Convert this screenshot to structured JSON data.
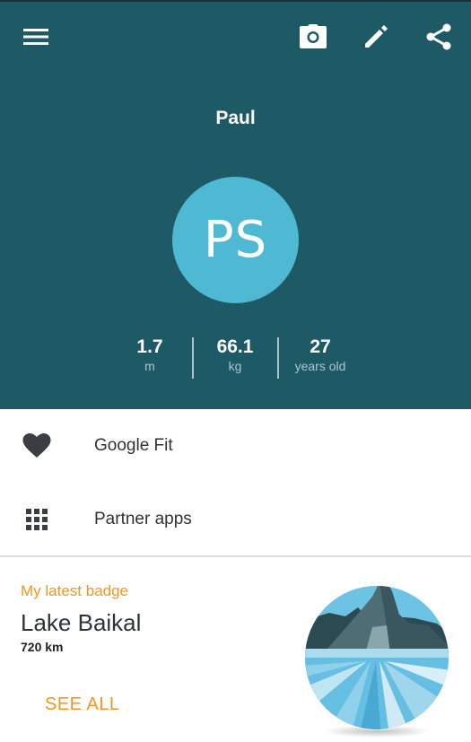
{
  "colors": {
    "header_bg": "#1d5a66",
    "avatar_bg": "#4fb8d3",
    "accent": "#f7941d",
    "text_dark": "#2f3338",
    "stat_unit": "#a9c6cc"
  },
  "toolbar": {
    "menu_icon": "hamburger-menu-icon",
    "camera_icon": "camera-icon",
    "edit_icon": "pencil-icon",
    "share_icon": "share-icon"
  },
  "profile": {
    "name": "Paul",
    "initials": "PS",
    "stats": [
      {
        "value": "1.7",
        "unit": "m"
      },
      {
        "value": "66.1",
        "unit": "kg"
      },
      {
        "value": "27",
        "unit": "years old"
      }
    ]
  },
  "menu": {
    "items": [
      {
        "label": "Google Fit",
        "icon": "heart-icon"
      },
      {
        "label": "Partner apps",
        "icon": "apps-grid-icon"
      }
    ]
  },
  "badge": {
    "caption": "My latest badge",
    "title": "Lake Baikal",
    "distance": "720 km",
    "see_all_label": "SEE ALL",
    "image": "lake-baikal-badge-illustration"
  }
}
